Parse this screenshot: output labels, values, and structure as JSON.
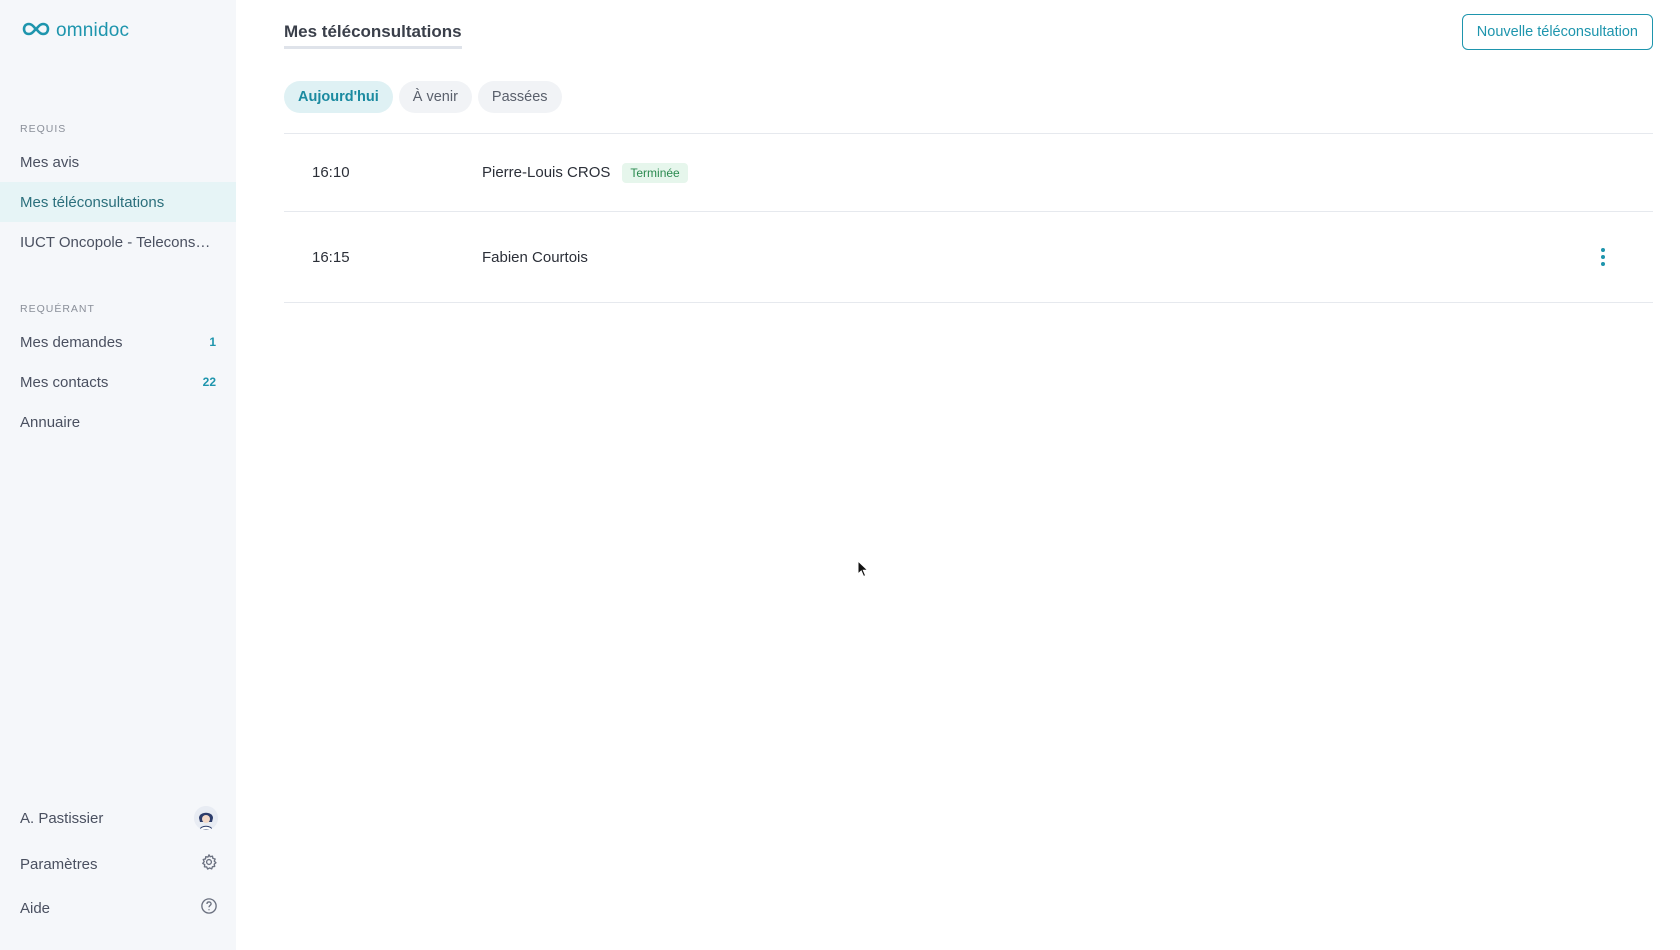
{
  "brand": {
    "name": "omnidoc",
    "color": "#1e95ad",
    "icon": "infinity-logo-icon"
  },
  "sidebar": {
    "sections": [
      {
        "label": "REQUIS",
        "items": [
          {
            "label": "Mes avis",
            "active": false
          },
          {
            "label": "Mes téléconsultations",
            "active": true
          },
          {
            "label": "IUCT Oncopole - Teleconsult...",
            "active": false
          }
        ]
      },
      {
        "label": "REQUÉRANT",
        "items": [
          {
            "label": "Mes demandes",
            "badge": "1",
            "active": false
          },
          {
            "label": "Mes contacts",
            "badge": "22",
            "active": false
          },
          {
            "label": "Annuaire",
            "active": false
          }
        ]
      }
    ],
    "user": {
      "name": "A. Pastissier",
      "icon": "avatar-icon"
    },
    "settings": {
      "label": "Paramètres",
      "icon": "gear-icon"
    },
    "help": {
      "label": "Aide",
      "icon": "help-circle-icon"
    }
  },
  "main": {
    "title": "Mes téléconsultations",
    "new_button": "Nouvelle téléconsultation",
    "tabs": [
      {
        "label": "Aujourd'hui",
        "active": true
      },
      {
        "label": "À venir",
        "active": false
      },
      {
        "label": "Passées",
        "active": false
      }
    ],
    "rows": [
      {
        "time": "16:10",
        "patient": "Pierre-Louis CROS",
        "status": "Terminée",
        "menu": false
      },
      {
        "time": "16:15",
        "patient": "Fabien Courtois",
        "status": "",
        "menu": true
      }
    ]
  },
  "colors": {
    "accent": "#1e95ad",
    "status_done_bg": "#e6f6ec",
    "status_done_text": "#2a8a4f",
    "sidebar_bg": "#f5f7fa"
  }
}
